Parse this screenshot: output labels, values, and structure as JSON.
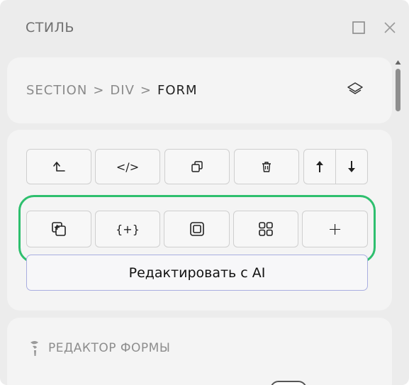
{
  "window": {
    "title": "СТИЛЬ"
  },
  "breadcrumb": {
    "items": [
      "SECTION",
      "DIV",
      "FORM"
    ],
    "separator": ">"
  },
  "toolbar_row1": [
    {
      "name": "select-parent",
      "icon": "arrow-up-left-icon"
    },
    {
      "name": "code",
      "icon": "code-icon",
      "label": "</>"
    },
    {
      "name": "duplicate",
      "icon": "copy-icon"
    },
    {
      "name": "delete",
      "icon": "trash-icon"
    },
    {
      "name": "move-up",
      "icon": "arrow-up-icon"
    },
    {
      "name": "move-down",
      "icon": "arrow-down-icon"
    }
  ],
  "toolbar_row2": [
    {
      "name": "add-element",
      "icon": "add-layer-icon"
    },
    {
      "name": "insert-variable",
      "icon": "braces-plus-icon",
      "label": "{+}"
    },
    {
      "name": "wrap",
      "icon": "frame-icon"
    },
    {
      "name": "components",
      "icon": "grid-icon"
    },
    {
      "name": "add",
      "icon": "plus-icon",
      "label": "+"
    }
  ],
  "ai_button": {
    "label": "Редактировать с AI"
  },
  "form_editor": {
    "title": "РЕДАКТОР ФОРМЫ"
  },
  "colors": {
    "highlight": "#2ebf6e",
    "ai_border": "#a9aee0",
    "panel_bg": "#ececec",
    "card_bg": "#f4f4f4"
  }
}
